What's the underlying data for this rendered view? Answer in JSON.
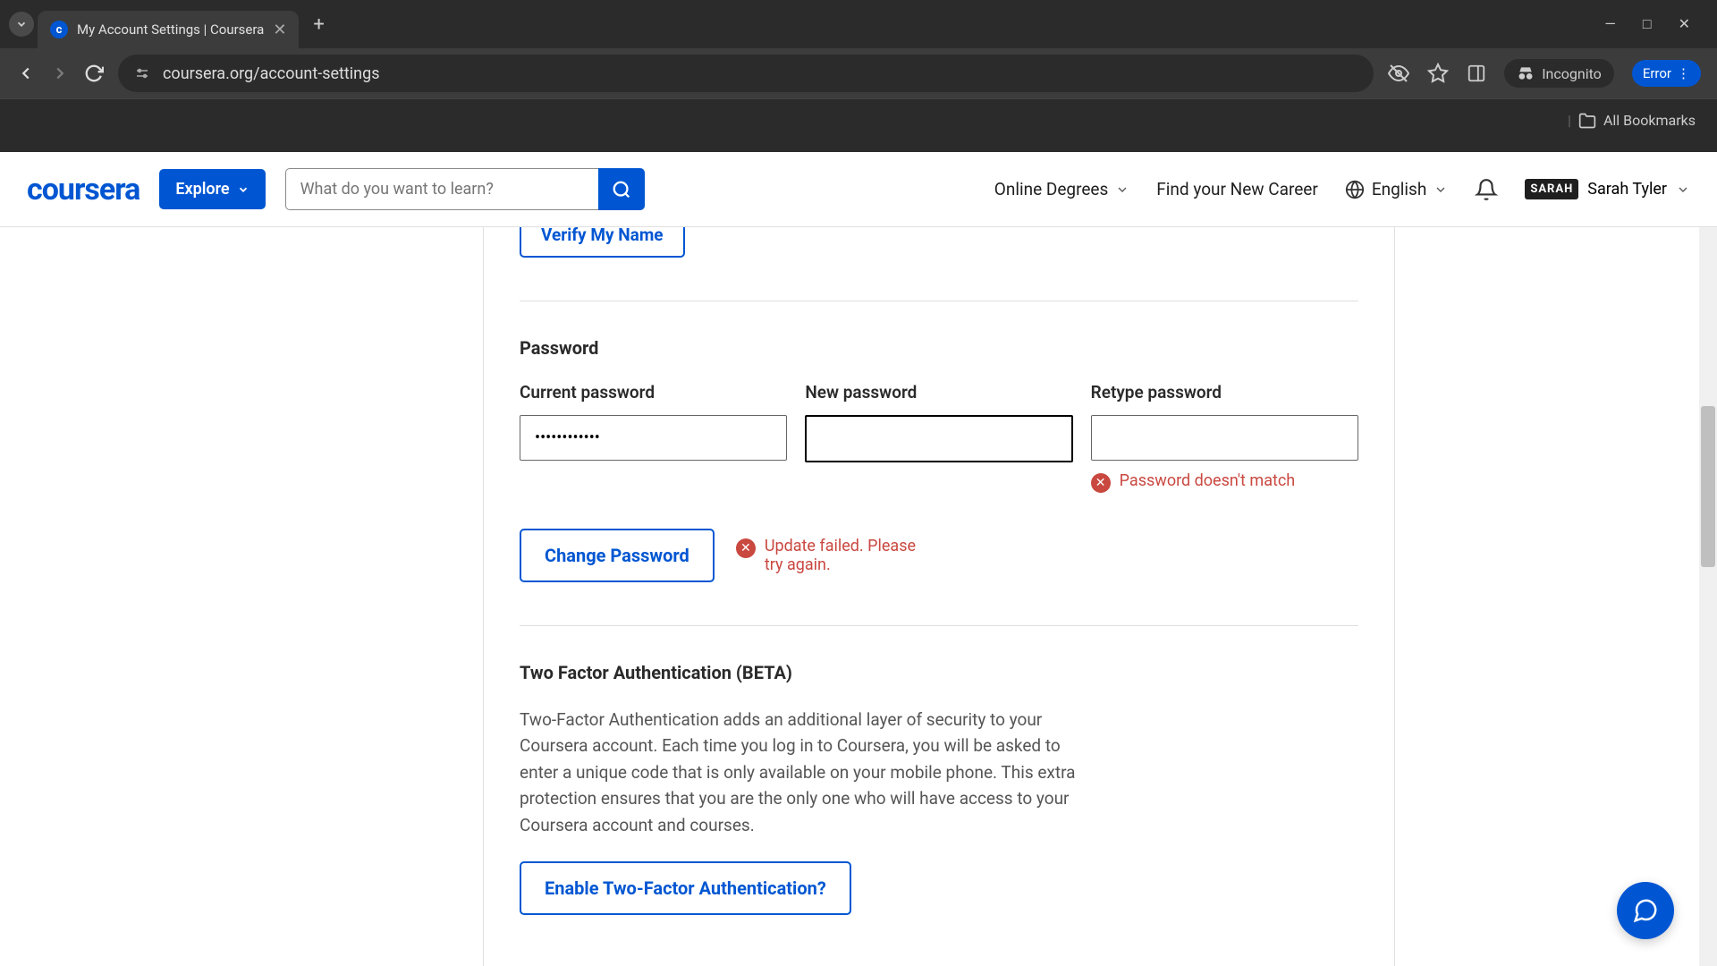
{
  "browser": {
    "tab_title": "My Account Settings | Coursera",
    "url": "coursera.org/account-settings",
    "incognito_label": "Incognito",
    "error_label": "Error",
    "bookmarks_label": "All Bookmarks"
  },
  "header": {
    "logo": "coursera",
    "explore": "Explore",
    "search_placeholder": "What do you want to learn?",
    "links": {
      "online_degrees": "Online Degrees",
      "new_career": "Find your New Career",
      "language": "English"
    },
    "user": {
      "badge": "SARAH",
      "name": "Sarah Tyler"
    }
  },
  "verify_name": {
    "button": "Verify My Name"
  },
  "password_section": {
    "title": "Password",
    "current_label": "Current password",
    "current_value": "••••••••••••",
    "new_label": "New password",
    "new_value": "",
    "retype_label": "Retype password",
    "retype_value": "",
    "retype_error": "Password doesn't match",
    "change_button": "Change Password",
    "update_error": "Update failed. Please try again."
  },
  "tfa_section": {
    "title": "Two Factor Authentication (BETA)",
    "description": "Two-Factor Authentication adds an additional layer of security to your Coursera account. Each time you log in to Coursera, you will be asked to enter a unique code that is only available on your mobile phone. This extra protection ensures that you are the only one who will have access to your Coursera account and courses.",
    "button": "Enable Two-Factor Authentication?"
  }
}
